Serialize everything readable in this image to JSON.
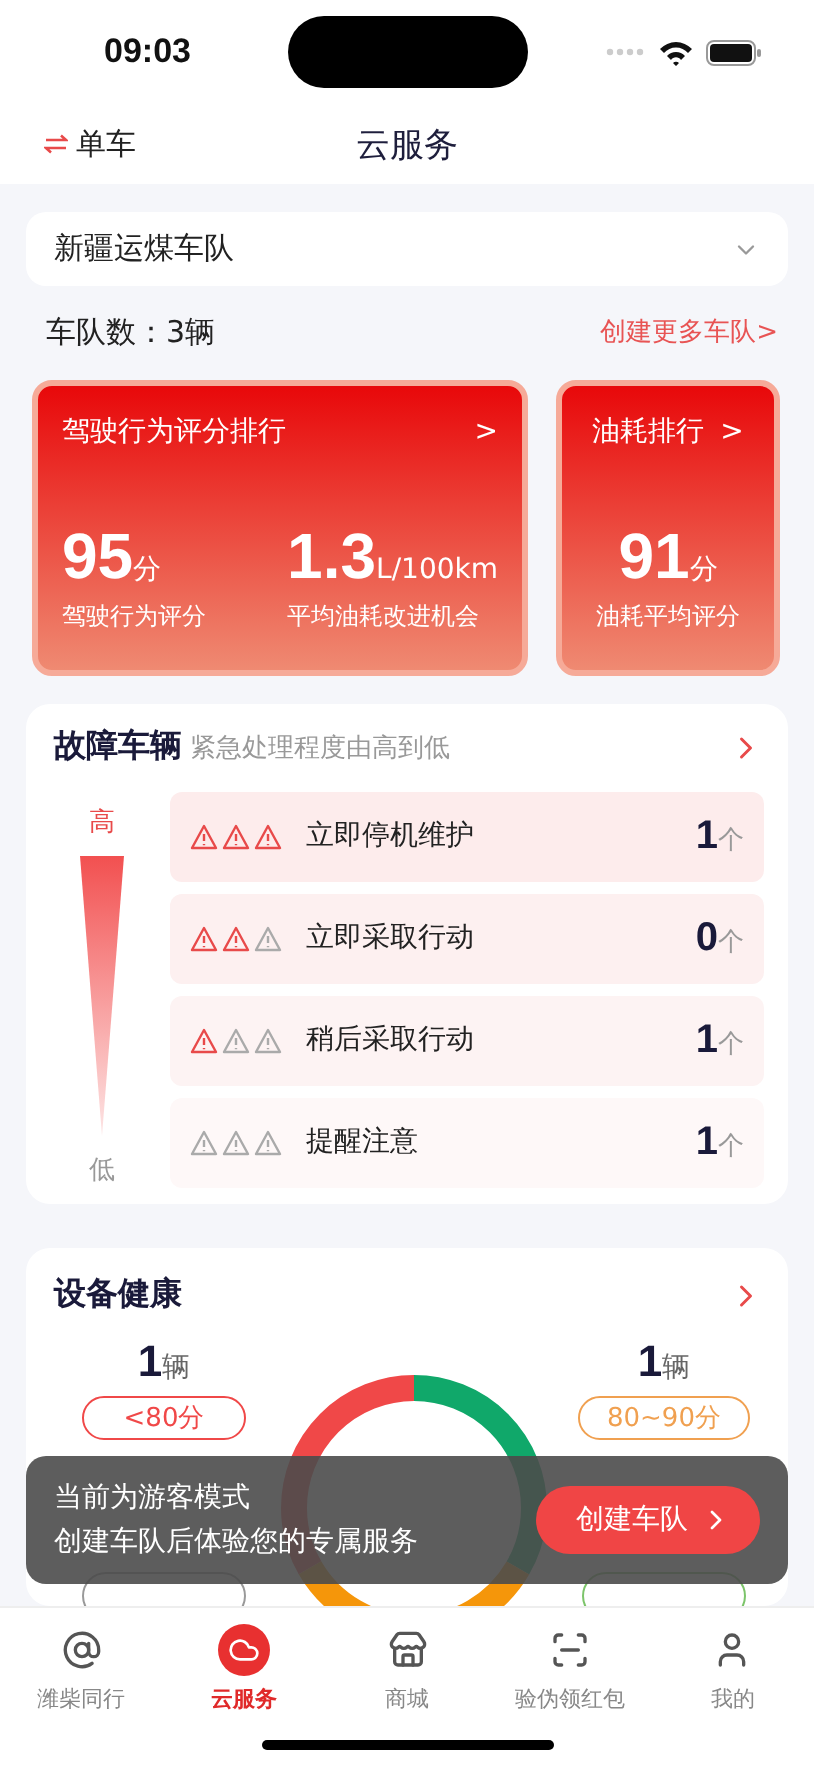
{
  "status_bar": {
    "time": "09:03"
  },
  "nav": {
    "switch_label": "单车",
    "title": "云服务"
  },
  "fleet_select": {
    "value": "新疆运煤车队"
  },
  "fleet_count": {
    "label": "车队数：3辆",
    "link": "创建更多车队>"
  },
  "score_cards": [
    {
      "title": "驾驶行为评分排行",
      "chevron": ">",
      "stats": [
        {
          "value": "95",
          "unit": "分",
          "label": "驾驶行为评分"
        },
        {
          "value": "1.3",
          "unit": "L/100km",
          "label": "平均油耗改进机会"
        }
      ]
    },
    {
      "title": "油耗排行",
      "chevron": ">",
      "stats": [
        {
          "value": "91",
          "unit": "分",
          "label": "油耗平均评分"
        }
      ]
    }
  ],
  "faults": {
    "title": "故障车辆",
    "subtitle": "紧急处理程度由高到低",
    "high": "高",
    "low": "低",
    "rows": [
      {
        "warnings": [
          {
            "on": true
          },
          {
            "on": true
          },
          {
            "on": true
          }
        ],
        "label": "立即停机维护",
        "count": "1",
        "unit": "个"
      },
      {
        "warnings": [
          {
            "on": true
          },
          {
            "on": true
          },
          {
            "on": false
          }
        ],
        "label": "立即采取行动",
        "count": "0",
        "unit": "个"
      },
      {
        "warnings": [
          {
            "on": true
          },
          {
            "on": false
          },
          {
            "on": false
          }
        ],
        "label": "稍后采取行动",
        "count": "1",
        "unit": "个"
      },
      {
        "warnings": [
          {
            "on": false
          },
          {
            "on": false
          },
          {
            "on": false
          }
        ],
        "label": "提醒注意",
        "count": "1",
        "unit": "个"
      }
    ]
  },
  "health": {
    "title": "设备健康",
    "groups": [
      {
        "count": "1",
        "unit": "辆",
        "badge": "<80分",
        "color": "#f04848"
      },
      {
        "count": "1",
        "unit": "辆",
        "badge": "80~90分",
        "color": "#f0a050"
      },
      {
        "color": "#999999"
      },
      {
        "color": "#7cc46a"
      }
    ]
  },
  "toast": {
    "lines": [
      "当前为游客模式",
      "创建车队后体验您的专属服务"
    ],
    "button": "创建车队"
  },
  "tabs": [
    {
      "kind": "at",
      "label": "潍柴同行",
      "selected": false
    },
    {
      "kind": "cloud",
      "label": "云服务",
      "selected": true
    },
    {
      "kind": "store",
      "label": "商城",
      "selected": false
    },
    {
      "kind": "scan",
      "label": "验伪领红包",
      "selected": false
    },
    {
      "kind": "user",
      "label": "我的",
      "selected": false
    }
  ]
}
